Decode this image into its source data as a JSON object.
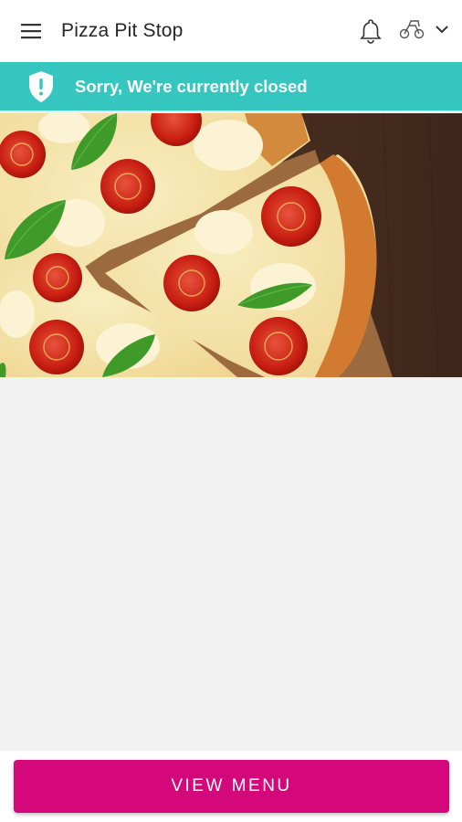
{
  "appbar": {
    "title": "Pizza Pit Stop",
    "menu_icon": "hamburger-menu-icon",
    "notification_icon": "bell-icon",
    "mode_icon": "delivery-pickup-icon",
    "dropdown_icon": "chevron-down-icon"
  },
  "banner": {
    "icon": "shield-alert-icon",
    "text": "Sorry, We're currently closed",
    "background": "#35c6c0"
  },
  "hero": {
    "image": "margherita-pizza-photo"
  },
  "footer": {
    "view_menu_label": "VIEW MENU",
    "button_color": "#d4087a"
  }
}
